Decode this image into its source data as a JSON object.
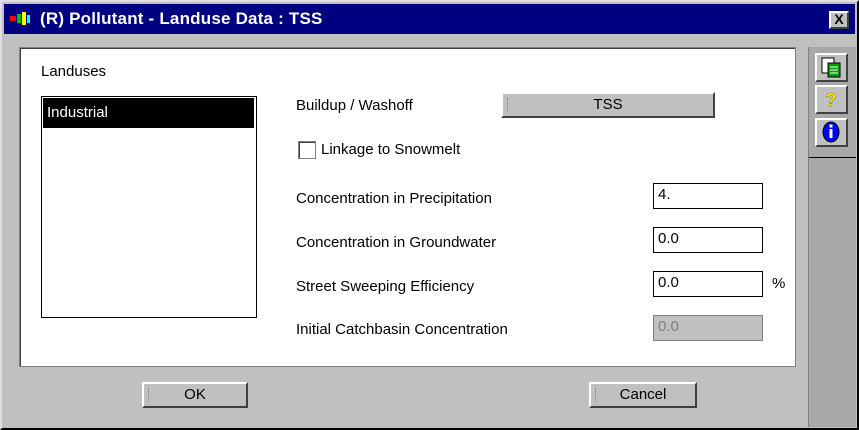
{
  "window": {
    "title": "(R) Pollutant - Landuse Data : TSS",
    "close_label": "X"
  },
  "landuses": {
    "label": "Landuses",
    "items": [
      "Industrial"
    ]
  },
  "buildup": {
    "label": "Buildup / Washoff",
    "button_label": "TSS"
  },
  "snowmelt": {
    "label": "Linkage to Snowmelt",
    "checked": false
  },
  "fields": {
    "precip": {
      "label": "Concentration in Precipitation",
      "value": "4."
    },
    "groundwater": {
      "label": "Concentration in Groundwater",
      "value": "0.0"
    },
    "sweeping": {
      "label": "Street Sweeping Efficiency",
      "value": "0.0",
      "unit": "%"
    },
    "catchbasin": {
      "label": "Initial Catchbasin Concentration",
      "value": "0.0",
      "disabled": true
    }
  },
  "actions": {
    "ok_label": "OK",
    "cancel_label": "Cancel"
  },
  "sidebar": {
    "icons": [
      "copy-icon",
      "help-icon",
      "info-icon"
    ]
  },
  "colors": {
    "title_bg": "#000080",
    "help_yellow": "#ffff00",
    "info_blue": "#0000ff"
  }
}
